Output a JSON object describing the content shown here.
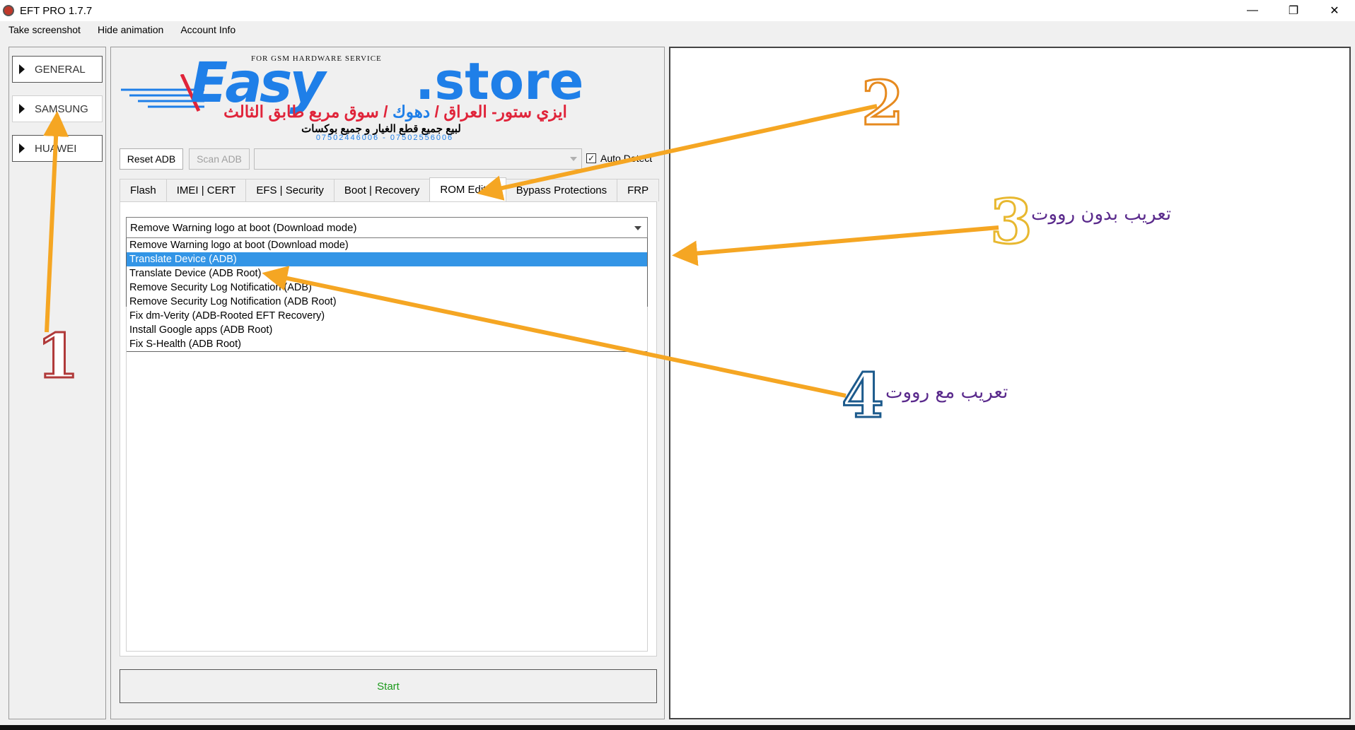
{
  "window": {
    "title": "EFT PRO 1.7.7",
    "minimize": "—",
    "maximize": "❐",
    "close": "✕"
  },
  "menu": [
    "Take screenshot",
    "Hide animation",
    "Account Info"
  ],
  "categories": [
    "GENERAL",
    "SAMSUNG",
    "HUAWEI"
  ],
  "logo": {
    "tagline": "FOR GSM HARDWARE SERVICE",
    "easy": "Easy",
    "store": ".store",
    "arabic_red": "ايزي ستور- العراق /",
    "arabic_blue": "دهوك",
    "arabic_red2": "/ سوق مربع طابق الثالث",
    "arabic_sub": "لبيع جميع قطع الغيار و جميع بوكسات",
    "phones": "07502446006 - 07502556006"
  },
  "adb": {
    "reset_label": "Reset ADB",
    "scan_label": "Scan ADB",
    "auto_detect_label": "Auto Detect",
    "auto_detect_checked": true
  },
  "tabs": [
    "Flash",
    "IMEI | CERT",
    "EFS | Security",
    "Boot | Recovery",
    "ROM Editor",
    "Bypass Protections",
    "FRP"
  ],
  "active_tab": "ROM Editor",
  "rom_editor": {
    "selected_value": "Remove Warning logo at boot (Download mode)",
    "options": [
      "Remove Warning logo at boot (Download mode)",
      "Translate Device (ADB)",
      "Translate Device (ADB Root)",
      "Remove Security Log Notification (ADB)",
      "Remove Security Log Notification (ADB Root)",
      "Fix dm-Verity (ADB-Rooted EFT Recovery)",
      "Install Google apps (ADB Root)",
      "Fix S-Health (ADB Root)"
    ],
    "highlighted_option": "Translate Device (ADB)"
  },
  "start_label": "Start",
  "annotations": {
    "n1": "1",
    "n2": "2",
    "n3": "3",
    "n4": "4",
    "note3": "تعريب بدون رووت",
    "note4": "تعريب مع رووت",
    "arrow_color": "#f5a623"
  }
}
